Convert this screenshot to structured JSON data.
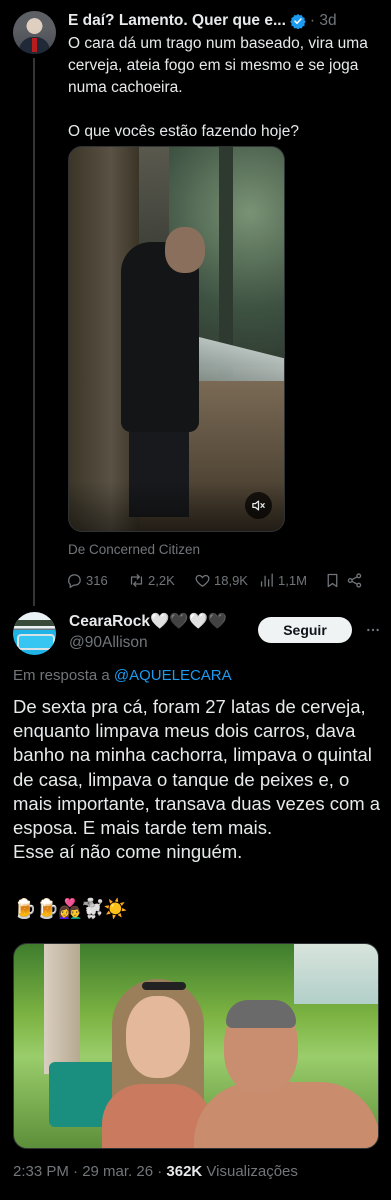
{
  "parent_tweet": {
    "author_name": "E daí? Lamento. Quer que e...",
    "time": "· 3d",
    "text": "O cara dá um trago num baseado, vira uma cerveja, ateia fogo em si mesmo e se joga numa cachoeira.\n\nO que vocês estão fazendo hoje?",
    "source": "De Concerned Citizen",
    "stats": {
      "replies": "316",
      "reposts": "2,2K",
      "likes": "18,9K",
      "views": "1,1M"
    },
    "icons": {
      "verified": "verified-badge-icon",
      "mute": "mute-icon",
      "reply": "reply-icon",
      "repost": "repost-icon",
      "like": "heart-icon",
      "views": "views-icon",
      "bookmark": "bookmark-icon",
      "share": "share-icon"
    }
  },
  "main_tweet": {
    "author_name": "CearaRock🤍🖤🤍🖤",
    "handle": "@90Allison",
    "follow_label": "Seguir",
    "replying_prefix": "Em resposta a",
    "replying_to": "@AQUELECARA",
    "text": "De sexta pra cá, foram 27 latas de cerveja, enquanto limpava meus dois carros, dava banho na minha cachorra, limpava o quintal de casa, limpava o tanque de peixes e, o mais importante, transava duas vezes com a esposa. E mais tarde tem mais.\nEsse aí não come ninguém.",
    "emojis": "🍺🍺👩‍❤️‍👨🐩☀️",
    "timestamp": "2:33 PM · 29 mar. 26 · ",
    "views_count": "362K",
    "views_label": " Visualizações",
    "icons": {
      "more": "more-options-icon"
    }
  },
  "colors": {
    "background": "#000000",
    "text_primary": "#e7e9ea",
    "text_secondary": "#71767b",
    "accent_link": "#1d9bf0",
    "verified_blue": "#1d9bf0",
    "follow_button_bg": "#eff3f4"
  }
}
